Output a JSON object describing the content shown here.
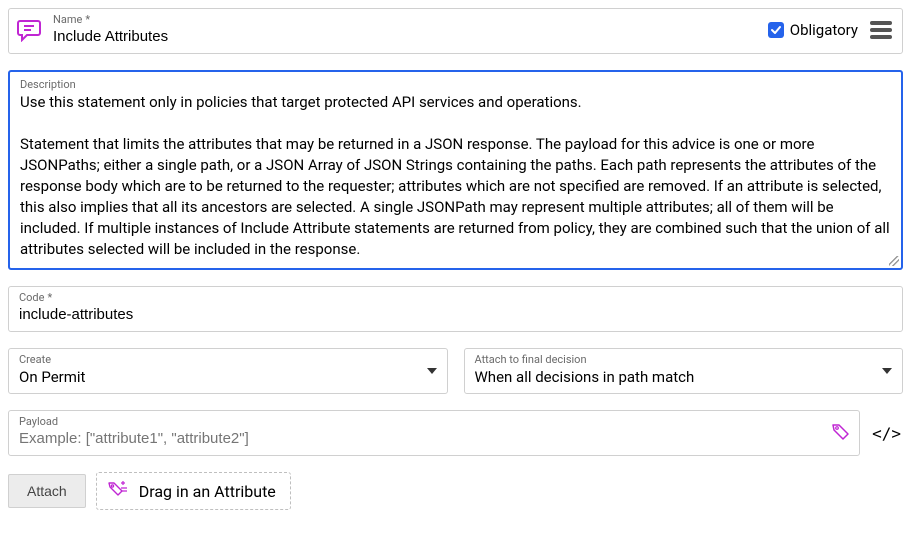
{
  "name": {
    "label": "Name",
    "required_marker": "*",
    "value": "Include Attributes"
  },
  "obligatory": {
    "label": "Obligatory",
    "checked": true
  },
  "description": {
    "label": "Description",
    "value": "Use this statement only in policies that target protected API services and operations.\n\nStatement that limits the attributes that may be returned in a JSON response. The payload for this advice is one or more JSONPaths; either a single path, or a JSON Array of JSON Strings containing the paths. Each path represents the attributes of the response body which are to be returned to the requester; attributes which are not specified are removed. If an attribute is selected, this also implies that all its ancestors are selected. A single JSONPath may represent multiple attributes; all of them will be included. If multiple instances of Include Attribute statements are returned from policy, they are combined such that the union of all attributes selected will be included in the response."
  },
  "code": {
    "label": "Code",
    "required_marker": "*",
    "value": "include-attributes"
  },
  "create": {
    "label": "Create",
    "value": "On Permit"
  },
  "attach_decision": {
    "label": "Attach to final decision",
    "value": "When all decisions in path match"
  },
  "payload": {
    "label": "Payload",
    "placeholder": "Example: [\"attribute1\", \"attribute2\"]"
  },
  "attach_button": "Attach",
  "drag_text": "Drag in an Attribute",
  "colors": {
    "accent_blue": "#2563eb",
    "accent_magenta": "#c026d3"
  }
}
